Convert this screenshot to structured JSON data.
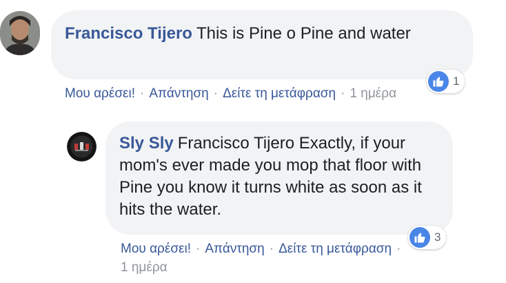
{
  "comment": {
    "author": "Francisco Tijero",
    "text": "This is Pine o Pine and water",
    "reaction_count": "1",
    "actions": {
      "like": "Μου αρέσει!",
      "reply": "Απάντηση",
      "translate": "Δείτε τη μετάφραση",
      "time": "1 ημέρα"
    }
  },
  "reply": {
    "author": "Sly Sly",
    "text": "Francisco Tijero Exactly, if your mom's ever made you mop that floor with Pine you know it turns white as soon as it hits the water.",
    "reaction_count": "3",
    "actions": {
      "like": "Μου αρέσει!",
      "reply": "Απάντηση",
      "translate": "Δείτε τη μετάφραση",
      "time": "1 ημέρα"
    }
  },
  "colors": {
    "link": "#385898",
    "bubble": "#f2f3f5",
    "like": "#4a86e8",
    "meta": "#90949c"
  },
  "icons": {
    "reaction": "thumbs-up-icon"
  }
}
